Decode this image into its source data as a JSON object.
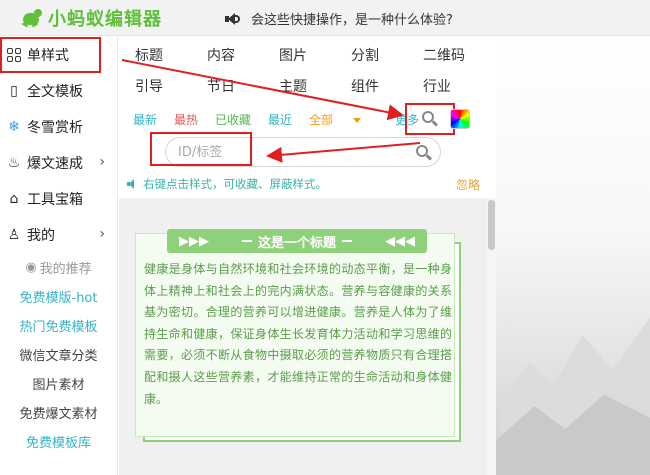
{
  "app": {
    "logo_text": "小蚂蚁编辑器",
    "notice": "会这些快捷操作，是一种什么体验?"
  },
  "sidebar": {
    "items": [
      {
        "label": "单样式",
        "icon": "grid-icon",
        "active": true
      },
      {
        "label": "全文模板",
        "icon": "template-icon"
      },
      {
        "label": "冬雪赏析",
        "icon": "snowflake-icon"
      },
      {
        "label": "爆文速成",
        "icon": "lightbulb-icon",
        "chevron": true
      },
      {
        "label": "工具宝箱",
        "icon": "toolbox-icon"
      },
      {
        "label": "我的",
        "icon": "user-icon",
        "chevron": true
      }
    ],
    "sub_items": [
      {
        "label": "我的推荐",
        "icon": "eye-icon"
      },
      {
        "label": "免费模版-hot"
      },
      {
        "label": "热门免费模板"
      },
      {
        "label": "微信文章分类"
      },
      {
        "label": "图片素材"
      },
      {
        "label": "免费爆文素材"
      },
      {
        "label": "免费模板库"
      }
    ]
  },
  "categories": [
    "标题",
    "内容",
    "图片",
    "分割",
    "二维码",
    "引导",
    "节日",
    "主题",
    "组件",
    "行业"
  ],
  "filters": {
    "newest": "最新",
    "hottest": "最热",
    "favorited": "已收藏",
    "recent": "最近",
    "all": "全部",
    "more": "更多"
  },
  "search": {
    "placeholder": "ID/标签"
  },
  "hint": "右键点击样式，可收藏、屏蔽样式。",
  "ignore": "忽略",
  "card": {
    "left_arrows": "▶▶▶",
    "title": "这是一个标题",
    "right_arrows": "◀◀◀",
    "body": "健康是身体与自然环境和社会环境的动态平衡，是一种身体上精神上和社会上的完内满状态。营养与容健康的关系基为密切。合理的营养可以增进健康。营养是人体为了维持生命和健康，保证身体生长发育体力活动和学习思维的需要，必须不断从食物中摄取必须的营养物质只有合理搭配和摄人这些营养素，才能维持正常的生命活动和身体健康。"
  },
  "colors": {
    "brand_green": "#5fc13a",
    "highlight_red": "#e02020",
    "card_green": "#8fd17a",
    "teal": "#36b3c6"
  }
}
